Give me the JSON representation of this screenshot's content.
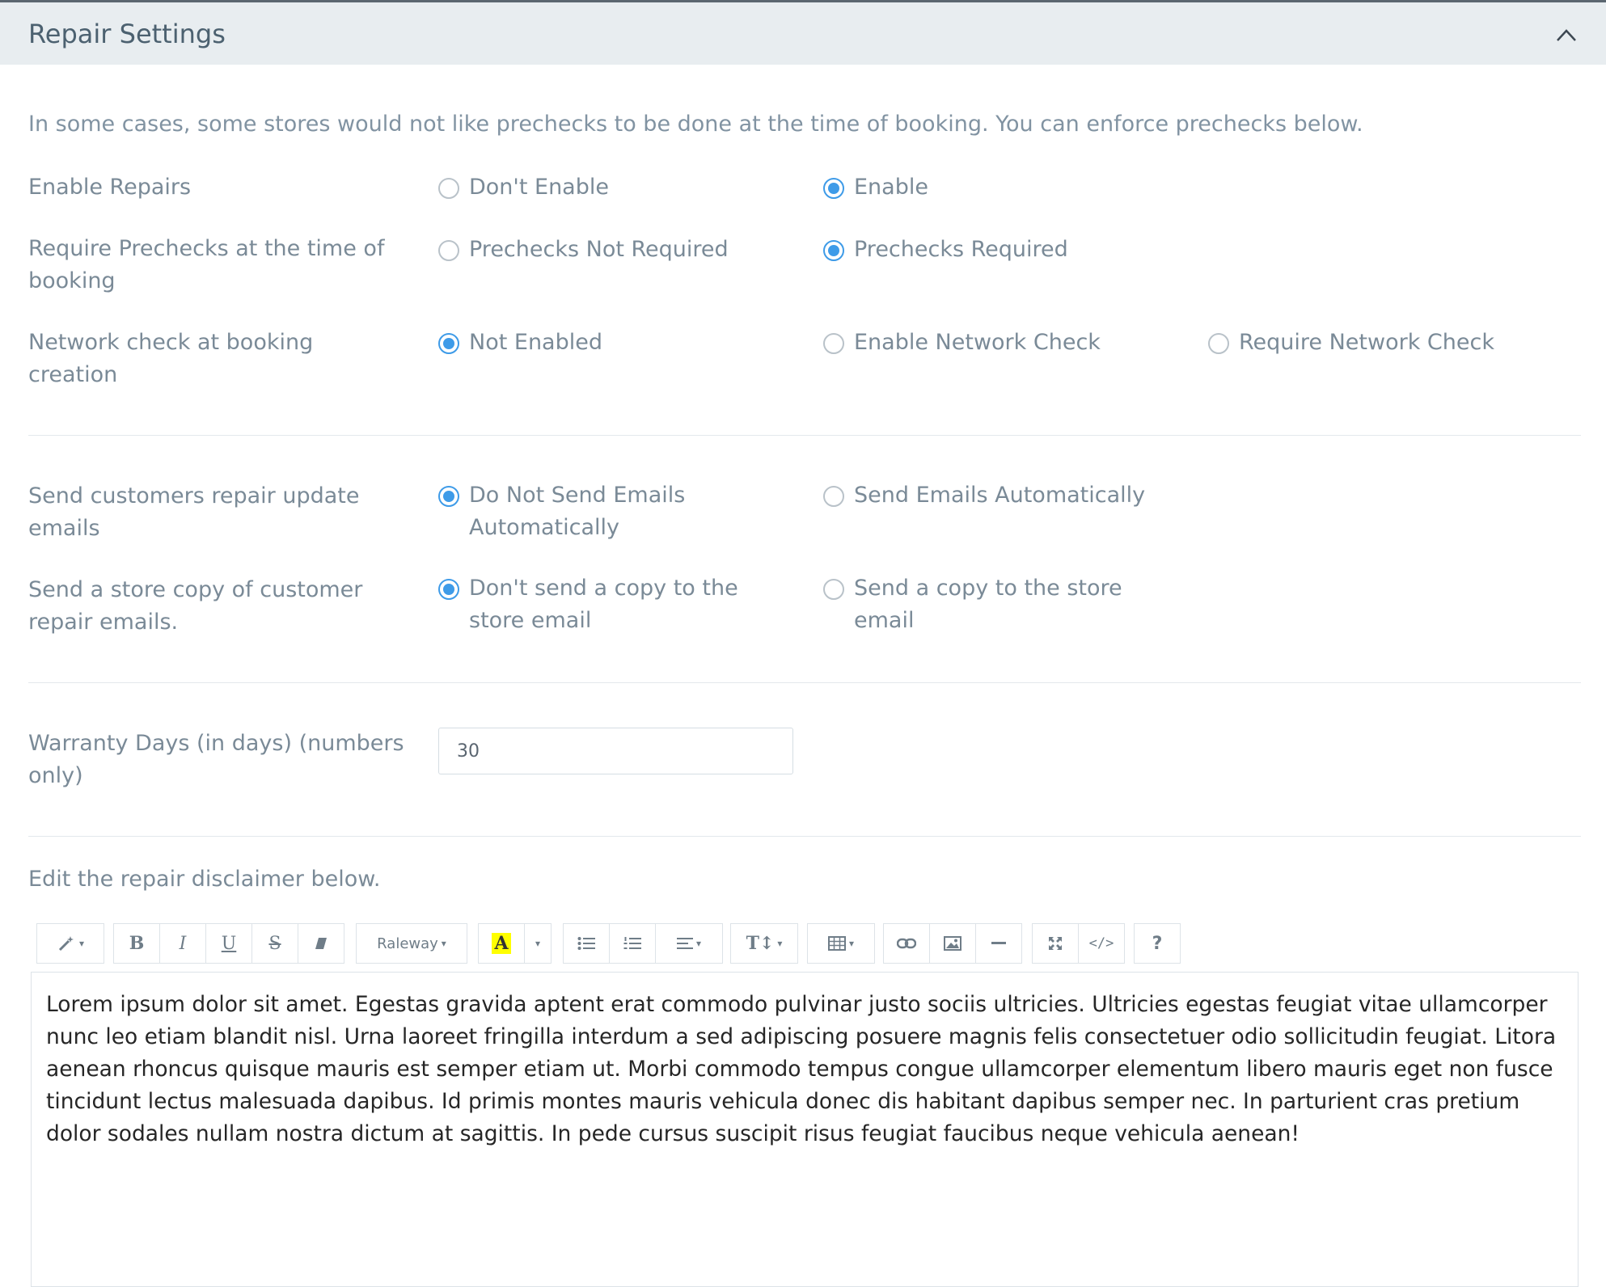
{
  "panel": {
    "title": "Repair Settings"
  },
  "intro_text": "In some cases, some stores would not like prechecks to be done at the time of booking. You can enforce prechecks below.",
  "settings": {
    "enable_repairs": {
      "label": "Enable Repairs",
      "options": [
        "Don't Enable",
        "Enable"
      ],
      "selected": "Enable"
    },
    "prechecks": {
      "label": "Require Prechecks at the time of booking",
      "options": [
        "Prechecks Not Required",
        "Prechecks Required"
      ],
      "selected": "Prechecks Required"
    },
    "network_check": {
      "label": "Network check at booking creation",
      "options": [
        "Not Enabled",
        "Enable Network Check",
        "Require Network Check"
      ],
      "selected": "Not Enabled"
    },
    "update_emails": {
      "label": "Send customers repair update emails",
      "options": [
        "Do Not Send Emails Automatically",
        "Send Emails Automatically"
      ],
      "selected": "Do Not Send Emails Automatically"
    },
    "store_copy": {
      "label": "Send a store copy of customer repair emails.",
      "options": [
        "Don't send a copy to the store email",
        "Send a copy to the store email"
      ],
      "selected": "Don't send a copy to the store email"
    },
    "warranty": {
      "label": "Warranty Days (in days) (numbers only)",
      "value": "30"
    }
  },
  "editor": {
    "label": "Edit the repair disclaimer below.",
    "toolbar": {
      "font_name": "Raleway",
      "code_label": "</>",
      "help_label": "?",
      "highlight_color": "#ffff00"
    },
    "content": "Lorem ipsum dolor sit amet. Egestas gravida aptent erat commodo pulvinar justo sociis ultricies. Ultricies egestas feugiat vitae ullamcorper nunc leo etiam blandit nisl. Urna laoreet fringilla interdum a sed adipiscing posuere magnis felis consectetuer odio sollicitudin feugiat. Litora aenean rhoncus quisque mauris est semper etiam ut. Morbi commodo tempus congue ullamcorper elementum libero mauris eget non fusce tincidunt lectus malesuada dapibus. Id primis montes mauris vehicula donec dis habitant dapibus semper nec. In parturient cras pretium dolor sodales nullam nostra dictum at sagittis. In pede cursus suscipit risus feugiat faucibus neque vehicula aenean!"
  },
  "colors": {
    "accent": "#3e9be8",
    "header_bg": "#e8edf0"
  }
}
